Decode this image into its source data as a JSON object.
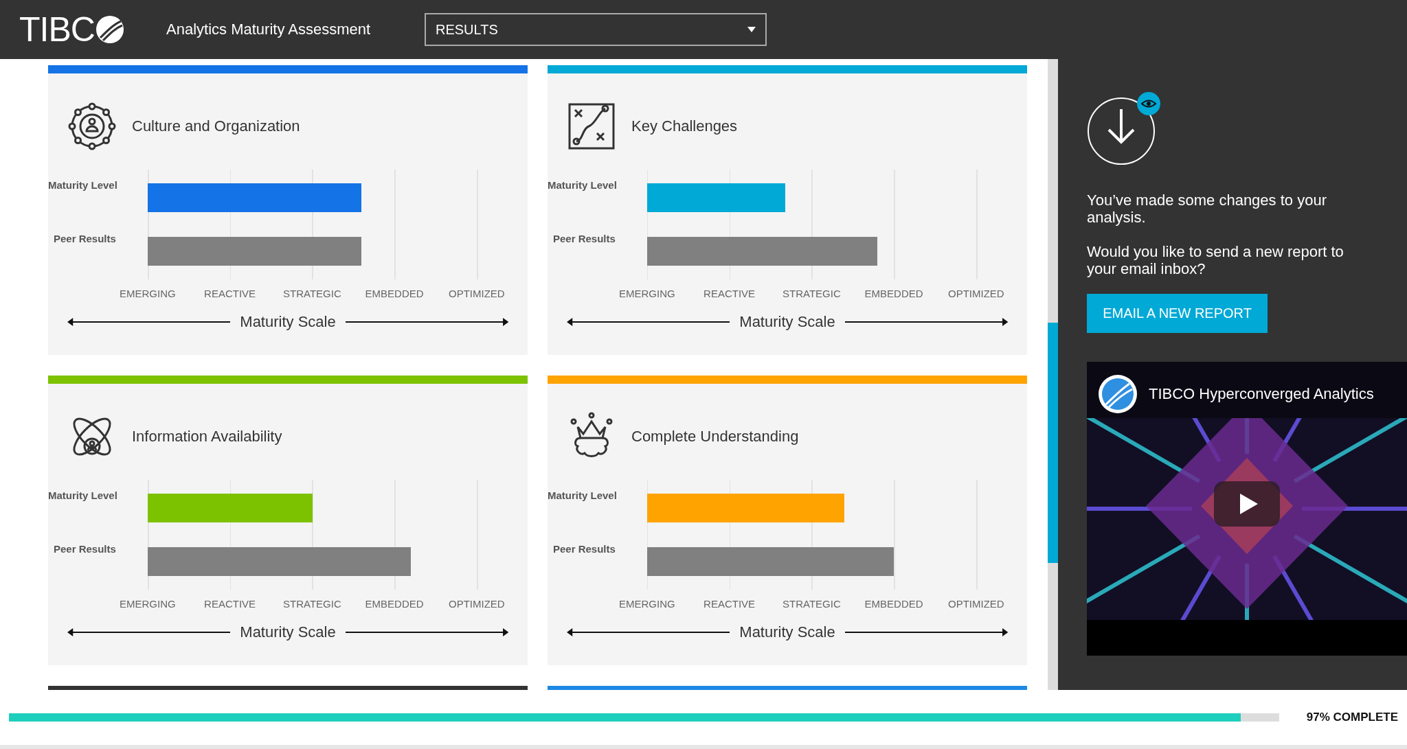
{
  "header": {
    "logo_text": "TIBC",
    "title": "Analytics Maturity Assessment",
    "dropdown": {
      "value": "RESULTS"
    }
  },
  "cards": [
    {
      "title": "Culture and Organization",
      "color": "#1473e6",
      "rows": [
        {
          "kind": "self",
          "label": "Maturity Level",
          "level": 0.65
        },
        {
          "kind": "peer",
          "label": "Peer Results",
          "level": 0.65
        }
      ],
      "scale_labels": [
        "EMERGING",
        "REACTIVE",
        "STRATEGIC",
        "EMBEDDED",
        "OPTIMIZED"
      ],
      "scale_title": "Maturity Scale"
    },
    {
      "title": "Key Challenges",
      "color": "#00a9d6",
      "rows": [
        {
          "kind": "self",
          "label": "Maturity Level",
          "level": 0.42
        },
        {
          "kind": "peer",
          "label": "Peer Results",
          "level": 0.7
        }
      ],
      "scale_labels": [
        "EMERGING",
        "REACTIVE",
        "STRATEGIC",
        "EMBEDDED",
        "OPTIMIZED"
      ],
      "scale_title": "Maturity Scale"
    },
    {
      "title": "Information Availability",
      "color": "#7dc200",
      "rows": [
        {
          "kind": "self",
          "label": "Maturity Level",
          "level": 0.5
        },
        {
          "kind": "peer",
          "label": "Peer Results",
          "level": 0.8
        }
      ],
      "scale_labels": [
        "EMERGING",
        "REACTIVE",
        "STRATEGIC",
        "EMBEDDED",
        "OPTIMIZED"
      ],
      "scale_title": "Maturity Scale"
    },
    {
      "title": "Complete Understanding",
      "color": "#ffa300",
      "rows": [
        {
          "kind": "self",
          "label": "Maturity Level",
          "level": 0.6
        },
        {
          "kind": "peer",
          "label": "Peer Results",
          "level": 0.75
        }
      ],
      "scale_labels": [
        "EMERGING",
        "REACTIVE",
        "STRATEGIC",
        "EMBEDDED",
        "OPTIMIZED"
      ],
      "scale_title": "Maturity Scale"
    }
  ],
  "next_cards": [
    {
      "color": "#333333"
    },
    {
      "color": "#1e88e5"
    }
  ],
  "panel": {
    "messages": [
      "You’ve made some changes to your analysis.",
      "Would you like to send a new report to your email inbox?"
    ],
    "button": "EMAIL A NEW REPORT",
    "video": {
      "title": "TIBCO Hyperconverged Analytics"
    }
  },
  "progress": {
    "level": 0.97,
    "label": "97% COMPLETE"
  }
}
